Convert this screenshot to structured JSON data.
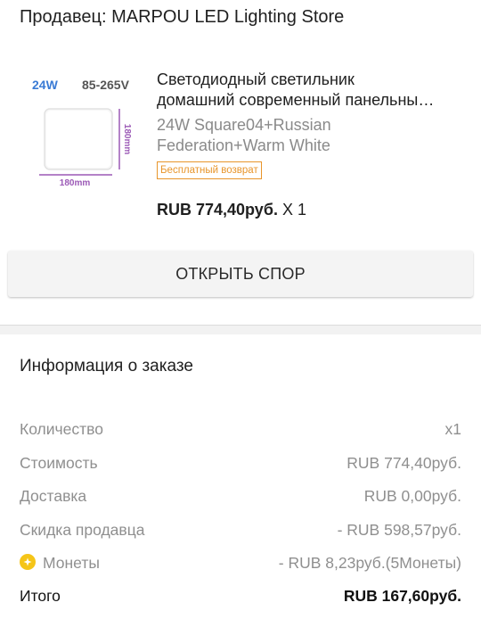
{
  "seller": "Продавец: MARPOU LED Lighting Store",
  "product": {
    "image_text": {
      "power": "24W",
      "voltage": "85-265V",
      "width": "180mm",
      "height": "180mm"
    },
    "title_line1": "Светодиодный светильник",
    "title_line2": "домашний современный панельны…",
    "variant_line1": "24W Square04+Russian",
    "variant_line2": "Federation+Warm White",
    "badge": "Бесплатный возврат",
    "price": "RUB 774,40руб.",
    "quantity": "X 1"
  },
  "dispute_button": "ОТКРЫТЬ СПОР",
  "order_info": {
    "title": "Информация о заказе",
    "rows": [
      {
        "label": "Количество",
        "value": "x1"
      },
      {
        "label": "Стоимость",
        "value": "RUB 774,40руб."
      },
      {
        "label": "Доставка",
        "value": "RUB 0,00руб."
      },
      {
        "label": "Скидка продавца",
        "value": "- RUB 598,57руб."
      },
      {
        "label": "Монеты",
        "value": "- RUB 8,23руб.(5Монеты)",
        "icon": "coin-icon"
      },
      {
        "label": "Итого",
        "value": "RUB 167,60руб."
      }
    ]
  },
  "colors": {
    "badge": "#e8952b",
    "coin": "#f5c518",
    "muted_text": "#8f8f8f"
  }
}
